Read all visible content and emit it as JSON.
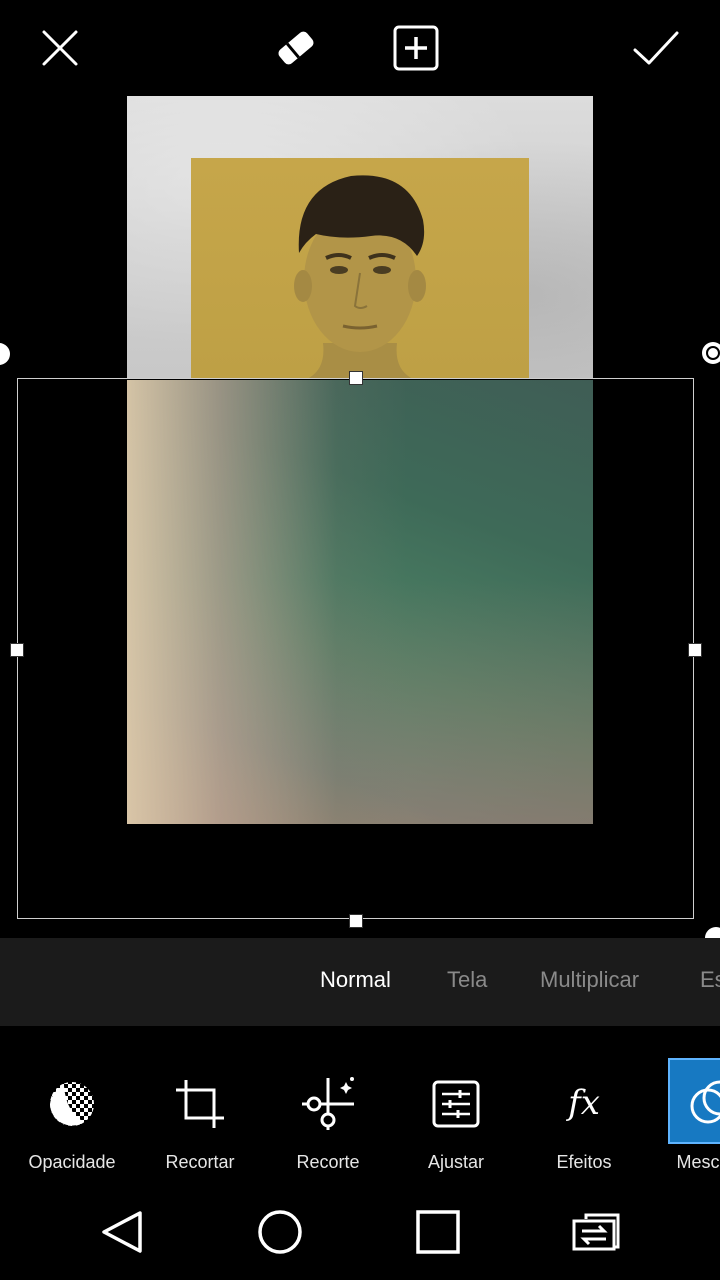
{
  "top_bar": {
    "close_icon": "close-icon",
    "eraser_icon": "eraser-icon",
    "add_icon": "add-icon",
    "apply_icon": "check-icon"
  },
  "blend_modes": {
    "options": [
      "Normal",
      "Tela",
      "Multiplicar",
      "Es"
    ],
    "selected": "Normal"
  },
  "tools": [
    {
      "label": "Opacidade",
      "icon": "opacity-icon"
    },
    {
      "label": "Recortar",
      "icon": "crop-icon"
    },
    {
      "label": "Recorte",
      "icon": "cutout-icon"
    },
    {
      "label": "Ajustar",
      "icon": "adjust-icon"
    },
    {
      "label": "Efeitos",
      "icon": "effects-icon"
    },
    {
      "label": "Mesc",
      "icon": "blend-icon",
      "selected": true
    }
  ],
  "colors": {
    "accent": "#1779c2",
    "toolbar_bg": "#1b1b1b",
    "background": "#000000"
  },
  "nav": [
    "back-icon",
    "home-icon",
    "recents-icon",
    "switch-app-icon"
  ]
}
